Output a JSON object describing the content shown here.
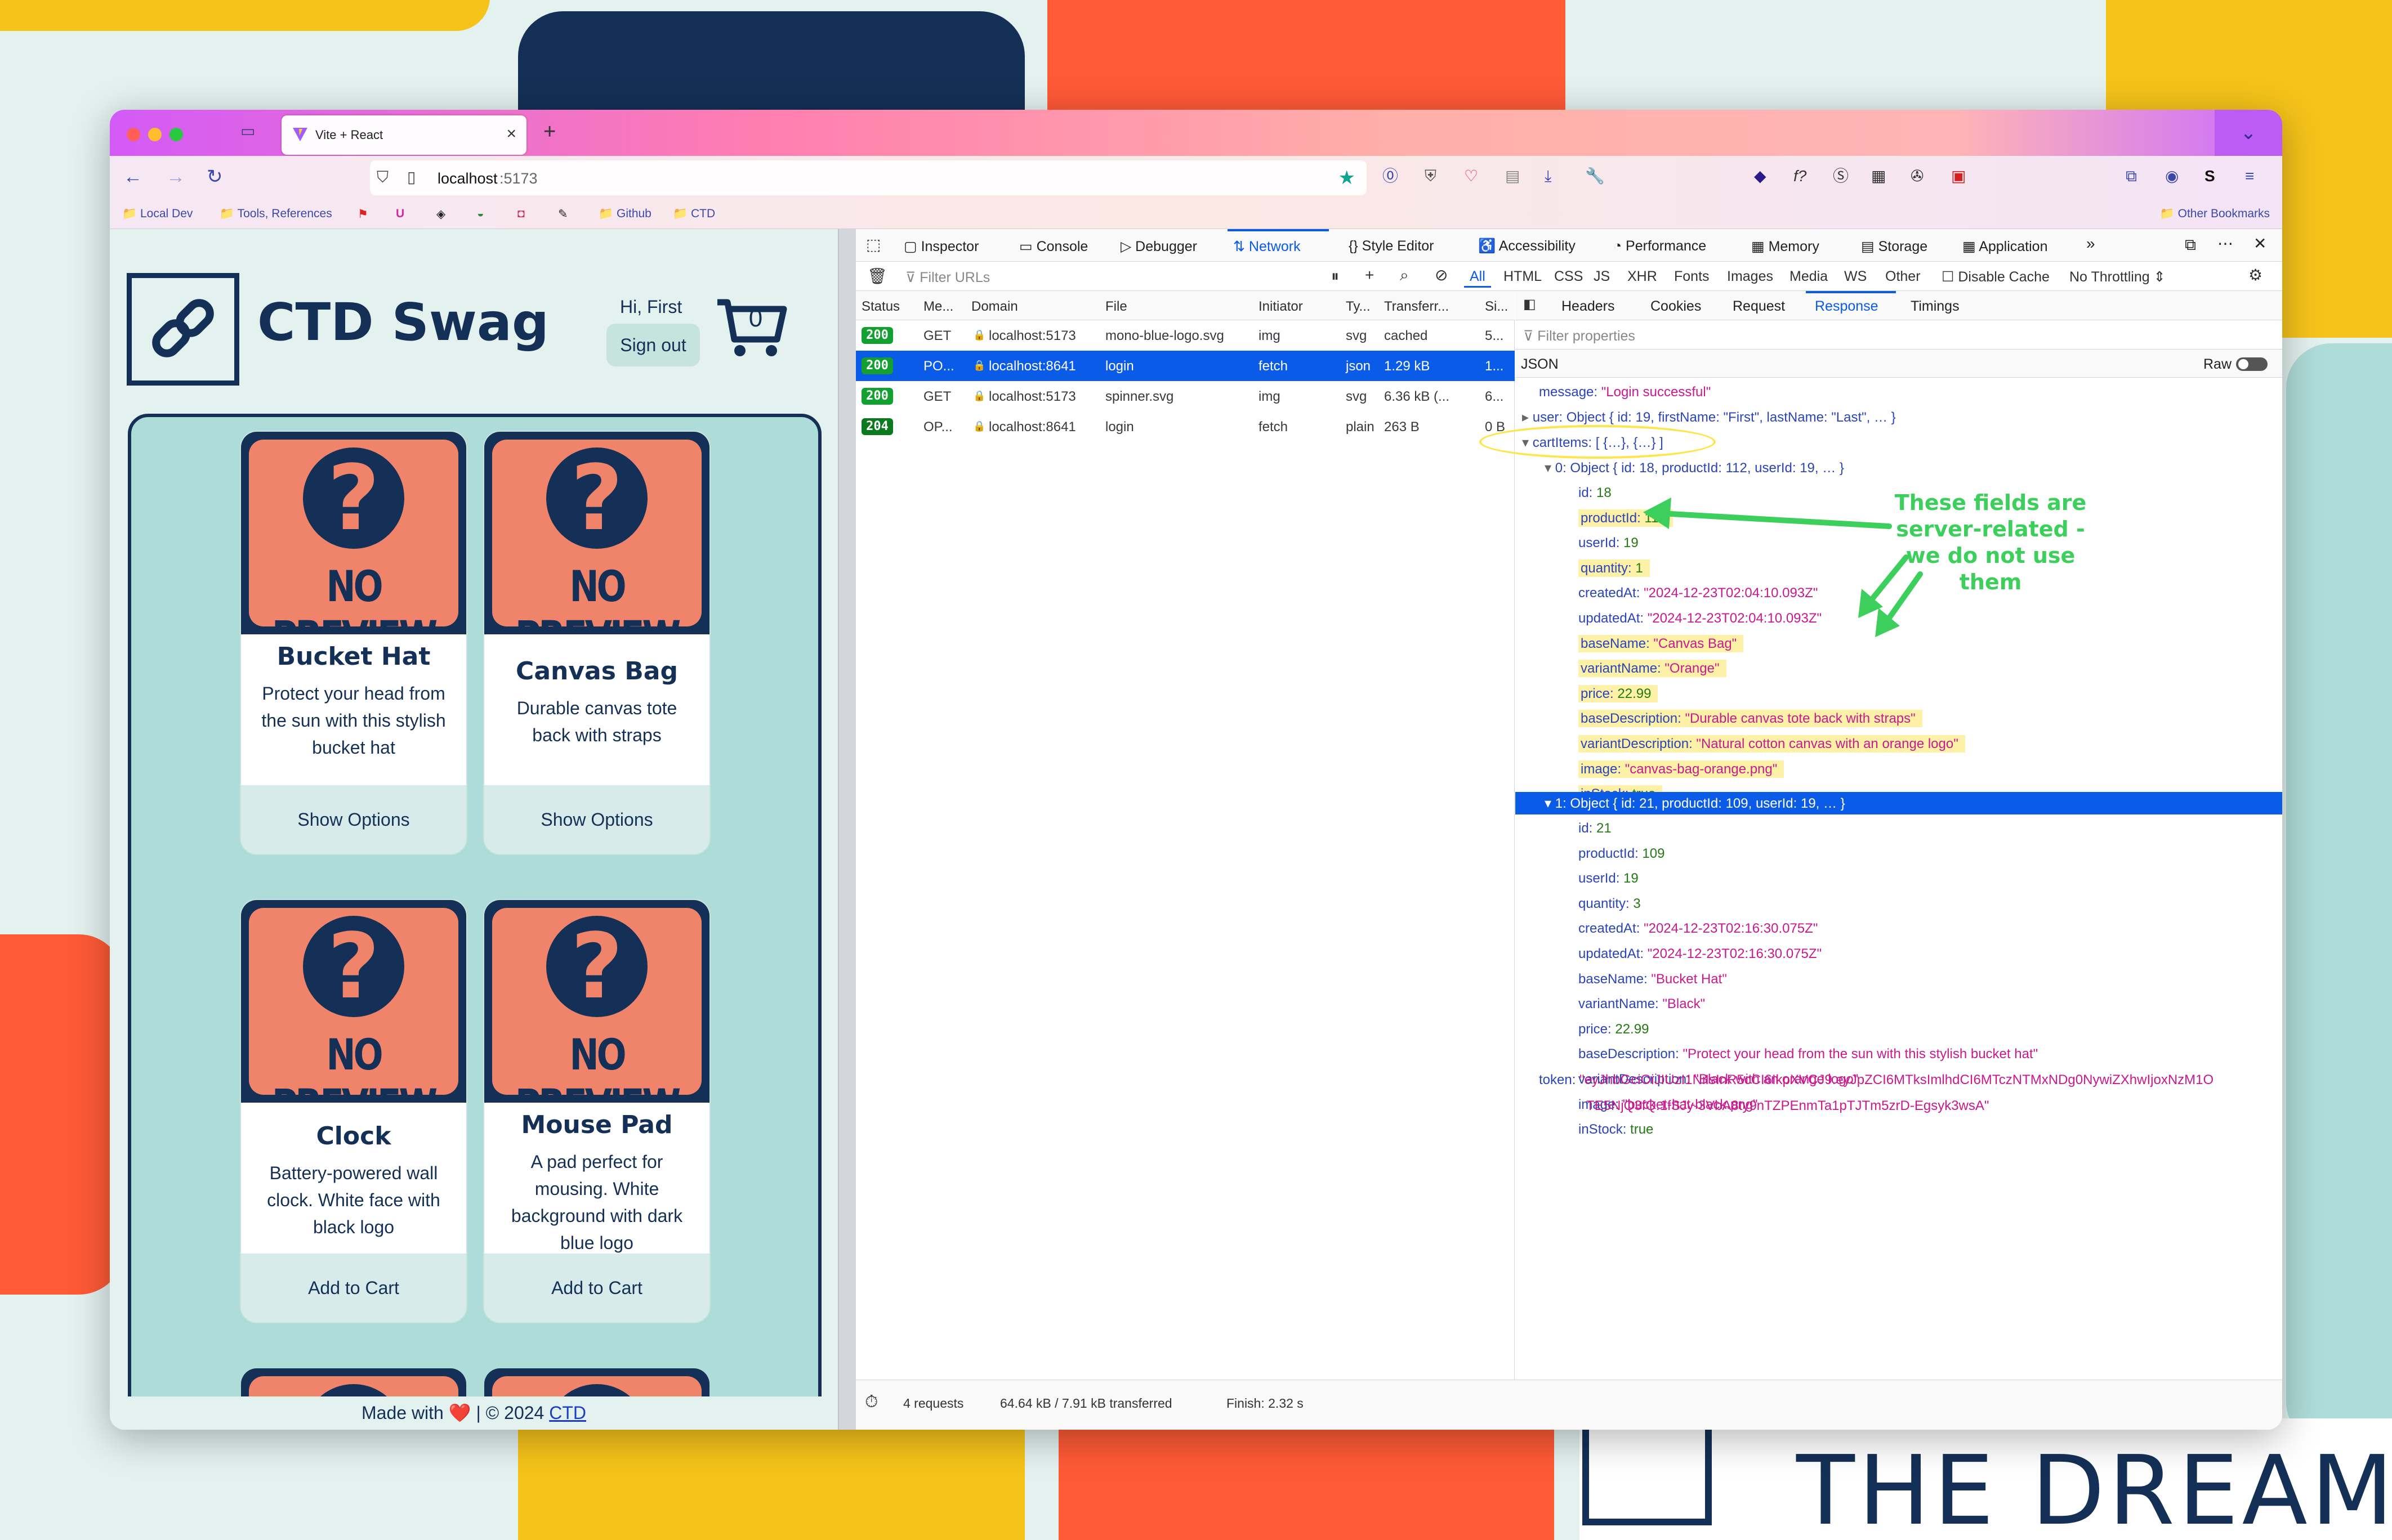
{
  "browser": {
    "tab_title": "Vite + React",
    "url_host": "localhost",
    "url_port": ":5173",
    "bookmarks": [
      "Local Dev",
      "Tools, References",
      "Github",
      "CTD"
    ],
    "other_bookmarks": "Other Bookmarks"
  },
  "app": {
    "brand": "CTD Swag",
    "greeting": "Hi, First",
    "signout": "Sign out",
    "cart_count": "0",
    "no_preview": "NO PREVIEW",
    "footer_pre": "Made with",
    "footer_heart": "❤️",
    "footer_post": "| © 2024",
    "footer_link": "CTD",
    "products": [
      {
        "title": "Bucket Hat",
        "desc": "Protect your head from the sun with this stylish bucket hat",
        "button": "Show Options"
      },
      {
        "title": "Canvas Bag",
        "desc": "Durable canvas tote back with straps",
        "button": "Show Options"
      },
      {
        "title": "Clock",
        "desc": "Battery-powered wall clock. White face with black logo",
        "button": "Add to Cart"
      },
      {
        "title": "Mouse Pad",
        "desc": "A pad perfect for mousing. White background with dark blue logo",
        "button": "Add to Cart"
      }
    ]
  },
  "devtools": {
    "tools": [
      "Inspector",
      "Console",
      "Debugger",
      "Network",
      "Style Editor",
      "Accessibility",
      "Performance",
      "Memory",
      "Storage",
      "Application"
    ],
    "active_tool": "Network",
    "filter_placeholder": "Filter URLs",
    "type_filters": [
      "All",
      "HTML",
      "CSS",
      "JS",
      "XHR",
      "Fonts",
      "Images",
      "Media",
      "WS",
      "Other"
    ],
    "disable_cache": "Disable Cache",
    "throttling": "No Throttling ⇕",
    "columns": [
      "Status",
      "Me...",
      "Domain",
      "File",
      "Initiator",
      "Ty...",
      "Transferr...",
      "Si..."
    ],
    "requests": [
      {
        "status": "200",
        "method": "GET",
        "domain": "localhost:5173",
        "file": "mono-blue-logo.svg",
        "initiator": "img",
        "type": "svg",
        "transferred": "cached",
        "size": "5...",
        "selected": false
      },
      {
        "status": "200",
        "method": "PO...",
        "domain": "localhost:8641",
        "file": "login",
        "initiator": "fetch",
        "type": "json",
        "transferred": "1.29 kB",
        "size": "1...",
        "selected": true
      },
      {
        "status": "200",
        "method": "GET",
        "domain": "localhost:5173",
        "file": "spinner.svg",
        "initiator": "img",
        "type": "svg",
        "transferred": "6.36 kB (...",
        "size": "6...",
        "selected": false
      },
      {
        "status": "204",
        "method": "OP...",
        "domain": "localhost:8641",
        "file": "login",
        "initiator": "fetch",
        "type": "plain",
        "transferred": "263 B",
        "size": "0 B",
        "selected": false
      }
    ],
    "detail_tabs": [
      "Headers",
      "Cookies",
      "Request",
      "Response",
      "Timings"
    ],
    "active_detail_tab": "Response",
    "filter_properties": "Filter properties",
    "json_label": "JSON",
    "raw_label": "Raw",
    "status_bar": {
      "requests": "4 requests",
      "transferred": "64.64 kB / 7.91 kB transferred",
      "finish": "Finish: 2.32 s"
    },
    "json": {
      "message_key": "message:",
      "message_val": "\"Login successful\"",
      "user_key": "user:",
      "user_val": "Object { id: 19, firstName: \"First\", lastName: \"Last\", … }",
      "cart_key": "cartItems:",
      "cart_val": "[ {…}, {…} ]",
      "item0_header": "0: Object { id: 18, productId: 112, userId: 19, … }",
      "item0": [
        {
          "key": "id:",
          "val": "18",
          "kind": "n",
          "hl": false
        },
        {
          "key": "productId:",
          "val": "112",
          "kind": "n",
          "hl": true
        },
        {
          "key": "userId:",
          "val": "19",
          "kind": "n",
          "hl": false
        },
        {
          "key": "quantity:",
          "val": "1",
          "kind": "n",
          "hl": true
        },
        {
          "key": "createdAt:",
          "val": "\"2024-12-23T02:04:10.093Z\"",
          "kind": "s",
          "hl": false
        },
        {
          "key": "updatedAt:",
          "val": "\"2024-12-23T02:04:10.093Z\"",
          "kind": "s",
          "hl": false
        },
        {
          "key": "baseName:",
          "val": "\"Canvas Bag\"",
          "kind": "s",
          "hl": true
        },
        {
          "key": "variantName:",
          "val": "\"Orange\"",
          "kind": "s",
          "hl": true
        },
        {
          "key": "price:",
          "val": "22.99",
          "kind": "n",
          "hl": true
        },
        {
          "key": "baseDescription:",
          "val": "\"Durable canvas tote back with straps\"",
          "kind": "s",
          "hl": true
        },
        {
          "key": "variantDescription:",
          "val": "\"Natural cotton canvas with an orange logo\"",
          "kind": "s",
          "hl": true
        },
        {
          "key": "image:",
          "val": "\"canvas-bag-orange.png\"",
          "kind": "s",
          "hl": true
        },
        {
          "key": "inStock:",
          "val": "true",
          "kind": "n",
          "hl": true
        }
      ],
      "item1_header": "1: Object { id: 21, productId: 109, userId: 19, … }",
      "item1": [
        {
          "key": "id:",
          "val": "21",
          "kind": "n",
          "hl": false
        },
        {
          "key": "productId:",
          "val": "109",
          "kind": "n",
          "hl": false
        },
        {
          "key": "userId:",
          "val": "19",
          "kind": "n",
          "hl": false
        },
        {
          "key": "quantity:",
          "val": "3",
          "kind": "n",
          "hl": false
        },
        {
          "key": "createdAt:",
          "val": "\"2024-12-23T02:16:30.075Z\"",
          "kind": "s",
          "hl": false
        },
        {
          "key": "updatedAt:",
          "val": "\"2024-12-23T02:16:30.075Z\"",
          "kind": "s",
          "hl": false
        },
        {
          "key": "baseName:",
          "val": "\"Bucket Hat\"",
          "kind": "s",
          "hl": false
        },
        {
          "key": "variantName:",
          "val": "\"Black\"",
          "kind": "s",
          "hl": false
        },
        {
          "key": "price:",
          "val": "22.99",
          "kind": "n",
          "hl": false
        },
        {
          "key": "baseDescription:",
          "val": "\"Protect your head from the sun with this stylish bucket hat\"",
          "kind": "s",
          "hl": false
        },
        {
          "key": "variantDescription:",
          "val": "\"Black with an orange logo\"",
          "kind": "s",
          "hl": false
        },
        {
          "key": "image:",
          "val": "\"bucket-hat-black.png\"",
          "kind": "s",
          "hl": false
        },
        {
          "key": "inStock:",
          "val": "true",
          "kind": "n",
          "hl": false
        }
      ],
      "token_key": "token:",
      "token_line1": "\"eyJhbGciOiJIUzI1NiIsInR5cCI6IkpXVCJ9.eyJpZCI6MTksImlhdCI6MTczNTMxNDg0NywiZXhwIjoxNzM1O",
      "token_line2": "TE5NjQ3fQ.1fSJy-3VbA8ty9nTZPEnmTa1pTJTm5zrD-Egsyk3wsA\""
    },
    "annotation": "These fields are server-related - we do not use them"
  },
  "background": {
    "banner_text": "THE DREAM"
  },
  "colors": {
    "accent": "#0a5be8",
    "navy": "#143056",
    "coral": "#f0846a",
    "teal": "#d7ecea",
    "annotation": "#3ccf5c"
  }
}
